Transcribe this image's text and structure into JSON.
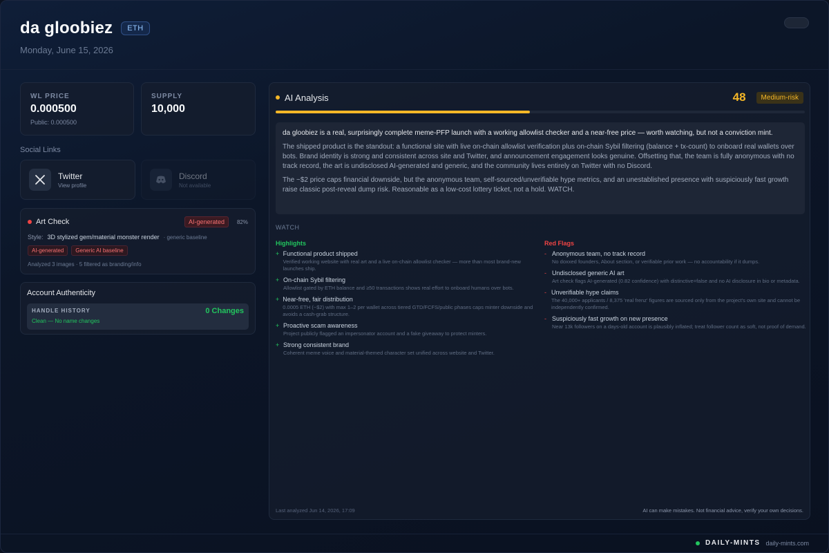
{
  "header": {
    "title": "da gloobiez",
    "chain": "ETH",
    "date": "Monday, June 15, 2026"
  },
  "stats": {
    "wl_label": "WL PRICE",
    "wl_value": "0.000500",
    "wl_sub": "Public: 0.000500",
    "supply_label": "SUPPLY",
    "supply_value": "10,000"
  },
  "social": {
    "title": "Social Links",
    "twitter": {
      "name": "Twitter",
      "sub": "View profile",
      "icon": "x-logo-icon"
    },
    "discord": {
      "name": "Discord",
      "sub": "Not available",
      "icon": "discord-icon"
    }
  },
  "art_check": {
    "title": "Art Check",
    "badge": "AI-generated",
    "confidence": "82%",
    "style_label": "Style:",
    "style_value": "3D stylized gem/material monster render",
    "style_note": "· generic baseline",
    "tags": [
      "AI-generated",
      "Generic AI baseline"
    ],
    "footer": "Analyzed 3 images · 5 filtered as branding/info",
    "status_color": "#ef4444"
  },
  "account": {
    "title": "Account Authenticity",
    "history_label": "HANDLE HISTORY",
    "changes": "0 Changes",
    "status": "Clean — No name changes"
  },
  "ai": {
    "title": "AI Analysis",
    "score": "48",
    "score_value": 48,
    "risk": "Medium-risk",
    "accent": "#f5b727",
    "summary_lead": "da gloobiez is a real, surprisingly complete meme-PFP launch with a working allowlist checker and a near-free price — worth watching, but not a conviction mint.",
    "summary_p1": "The shipped product is the standout: a functional site with live on-chain allowlist verification plus on-chain Sybil filtering (balance + tx-count) to onboard real wallets over bots. Brand identity is strong and consistent across site and Twitter, and announcement engagement looks genuine. Offsetting that, the team is fully anonymous with no track record, the art is undisclosed AI-generated and generic, and the community lives entirely on Twitter with no Discord.",
    "summary_p2": "The ~$2 price caps financial downside, but the anonymous team, self-sourced/unverifiable hype metrics, and an unestablished presence with suspiciously fast growth raise classic post-reveal dump risk. Reasonable as a low-cost lottery ticket, not a hold. WATCH.",
    "verdict": "WATCH",
    "highlights_title": "Highlights",
    "highlights": [
      {
        "title": "Functional product shipped",
        "desc": "Verified working website with real art and a live on-chain allowlist checker — more than most brand-new launches ship."
      },
      {
        "title": "On-chain Sybil filtering",
        "desc": "Allowlist gated by ETH balance and ≥50 transactions shows real effort to onboard humans over bots."
      },
      {
        "title": "Near-free, fair distribution",
        "desc": "0.0005 ETH (~$2) with max 1–2 per wallet across tiered GTD/FCFS/public phases caps minter downside and avoids a cash-grab structure."
      },
      {
        "title": "Proactive scam awareness",
        "desc": "Project publicly flagged an impersonator account and a fake giveaway to protect minters."
      },
      {
        "title": "Strong consistent brand",
        "desc": "Coherent meme voice and material-themed character set unified across website and Twitter."
      }
    ],
    "redflags_title": "Red Flags",
    "redflags": [
      {
        "title": "Anonymous team, no track record",
        "desc": "No doxxed founders, About section, or verifiable prior work — no accountability if it dumps."
      },
      {
        "title": "Undisclosed generic AI art",
        "desc": "Art check flags AI-generated (0.82 confidence) with distinctive=false and no AI disclosure in bio or metadata."
      },
      {
        "title": "Unverifiable hype claims",
        "desc": "The 40,000+ applicants / 8,375 'real frenz' figures are sourced only from the project's own site and cannot be independently confirmed."
      },
      {
        "title": "Suspiciously fast growth on new presence",
        "desc": "Near 13k followers on a days-old account is plausibly inflated; treat follower count as soft, not proof of demand."
      }
    ],
    "last_analyzed": "Last analyzed Jun 14, 2026, 17:09",
    "disclaimer": "AI can make mistakes. Not financial advice, verify your own decisions."
  },
  "footer": {
    "brand": "DAILY-MINTS",
    "domain": "daily-mints.com"
  }
}
